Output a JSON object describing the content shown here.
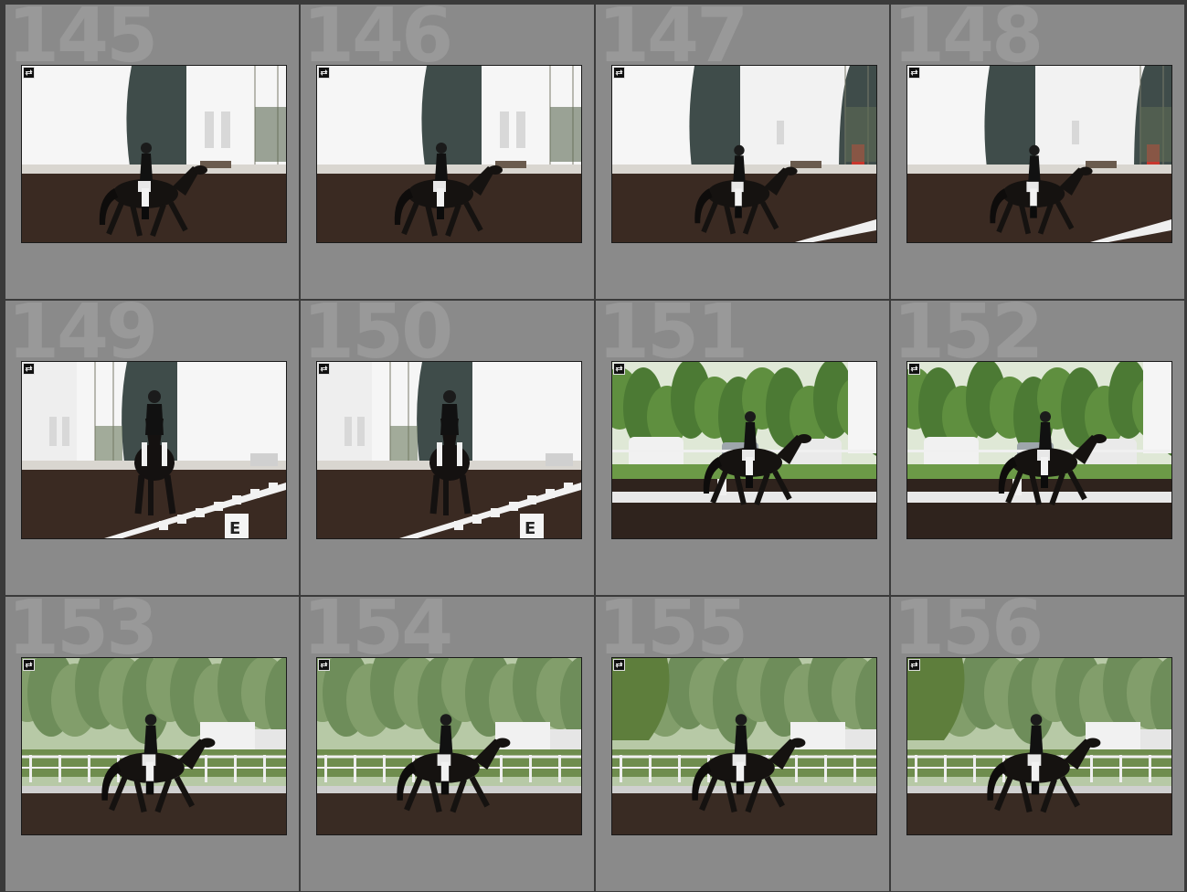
{
  "grid": {
    "cells": [
      {
        "number": "145",
        "scene": "arena-front",
        "flag": false
      },
      {
        "number": "146",
        "scene": "arena-front",
        "flag": false
      },
      {
        "number": "147",
        "scene": "arena-door",
        "flag": true
      },
      {
        "number": "148",
        "scene": "arena-door",
        "flag": true
      },
      {
        "number": "149",
        "scene": "arena-rail",
        "letter": "E"
      },
      {
        "number": "150",
        "scene": "arena-rail",
        "letter": "E"
      },
      {
        "number": "151",
        "scene": "trees-cars"
      },
      {
        "number": "152",
        "scene": "trees-cars"
      },
      {
        "number": "153",
        "scene": "forest-fence"
      },
      {
        "number": "154",
        "scene": "forest-fence"
      },
      {
        "number": "155",
        "scene": "forest-willow"
      },
      {
        "number": "156",
        "scene": "forest-willow"
      }
    ],
    "badge_icon": "sync-arrows-icon",
    "colors": {
      "cell_bg": "#8a8a8a",
      "number_watermark": "#999999",
      "separator": "#3a3a3a"
    }
  }
}
